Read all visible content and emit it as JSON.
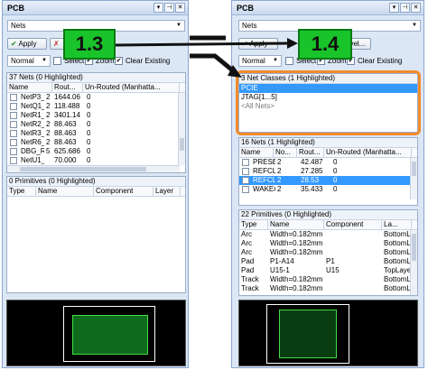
{
  "left": {
    "title": "PCB",
    "filter_value": "Nets",
    "apply_label": "Apply",
    "mode_value": "Normal",
    "select_label": "Select",
    "zoom_label": "Zoom",
    "clear_existing_label": "Clear Existing",
    "nets_header": "37 Nets (0 Highlighted)",
    "nets_columns": [
      "Name",
      "Rout...",
      "Un-Routed (Manhatta..."
    ],
    "nets": [
      {
        "name": "NetP3_4",
        "count": "2",
        "routed": "1644.06",
        "unrouted": "0"
      },
      {
        "name": "NetQ1_",
        "count": "2",
        "routed": "118.488",
        "unrouted": "0"
      },
      {
        "name": "NetR1_",
        "count": "2",
        "routed": "3401.14",
        "unrouted": "0"
      },
      {
        "name": "NetR2_",
        "count": "2",
        "routed": "88.463",
        "unrouted": "0"
      },
      {
        "name": "NetR3_",
        "count": "2",
        "routed": "88.463",
        "unrouted": "0"
      },
      {
        "name": "NetR6_",
        "count": "2",
        "routed": "88.463",
        "unrouted": "0"
      },
      {
        "name": "DBG_R",
        "count": "5",
        "routed": "625.686",
        "unrouted": "0"
      },
      {
        "name": "NetU1_",
        "count": "",
        "routed": "70.000",
        "unrouted": "0"
      }
    ],
    "prims_header": "0 Primitives (0 Highlighted)",
    "prims_columns": [
      "Type",
      "Name",
      "Component",
      "Layer"
    ]
  },
  "right": {
    "title": "PCB",
    "filter_value": "Nets",
    "apply_label": "Apply",
    "level_label": "evel...",
    "mode_value": "Normal",
    "select_label": "Select",
    "zoom_label": "Zoom",
    "clear_existing_label": "Clear Existing",
    "classes_header": "3 Net Classes (1 Highlighted)",
    "classes": [
      "PCIE",
      "JTAG[1...5]",
      "<All Nets>"
    ],
    "nets_header": "16 Nets (1 Highlighted)",
    "nets_columns": [
      "Name",
      "No...",
      "Rout...",
      "Un-Routed (Manhatta..."
    ],
    "nets": [
      {
        "name": "PRESEN",
        "count": "2",
        "routed": "42.487",
        "unrouted": "0"
      },
      {
        "name": "REFCLK",
        "count": "2",
        "routed": "27.285",
        "unrouted": "0"
      },
      {
        "name": "REFCLK",
        "count": "2",
        "routed": "28.53",
        "unrouted": "0"
      },
      {
        "name": "WAKE#",
        "count": "2",
        "routed": "35.433",
        "unrouted": "0"
      }
    ],
    "prims_header": "22 Primitives (0 Highlighted)",
    "prims_columns": [
      "Type",
      "Name",
      "Component",
      "La..."
    ],
    "prims": [
      {
        "type": "Arc",
        "name": "Width=0.182mm",
        "component": "",
        "layer": "BottomL"
      },
      {
        "type": "Arc",
        "name": "Width=0.182mm",
        "component": "",
        "layer": "BottomL"
      },
      {
        "type": "Arc",
        "name": "Width=0.182mm",
        "component": "",
        "layer": "BottomL"
      },
      {
        "type": "Pad",
        "name": "P1-A14",
        "component": "P1",
        "layer": "BottomL"
      },
      {
        "type": "Pad",
        "name": "U15-1",
        "component": "U15",
        "layer": "TopLaye"
      },
      {
        "type": "Track",
        "name": "Width=0.182mm",
        "component": "",
        "layer": "BottomL"
      },
      {
        "type": "Track",
        "name": "Width=0.182mm",
        "component": "",
        "layer": "BottomL"
      }
    ]
  },
  "callouts": {
    "first": "1.3",
    "second": "1.4"
  },
  "colors": {
    "highlight_orange": "#f18b2b",
    "callout_green": "#19c42a",
    "selection_blue": "#3399ff"
  }
}
